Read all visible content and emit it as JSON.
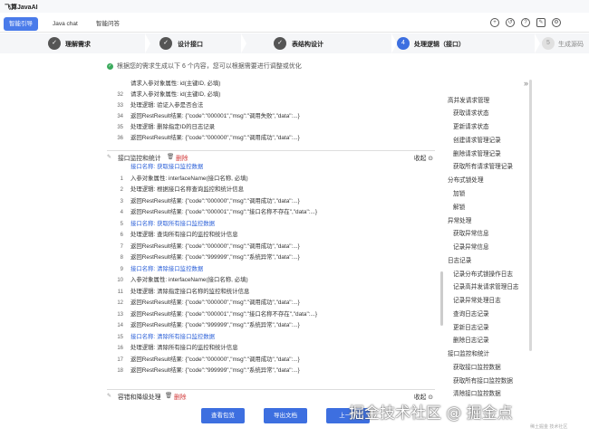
{
  "app": {
    "title": "飞算JavaAI"
  },
  "tabs": [
    {
      "label": "智能引导",
      "active": true
    },
    {
      "label": "Java chat",
      "active": false
    },
    {
      "label": "智能问答",
      "active": false
    }
  ],
  "toolbar_icons": [
    "add-icon",
    "history-icon",
    "help-icon",
    "edit-icon",
    "settings-icon"
  ],
  "steps": [
    {
      "num": "✓",
      "label": "理解需求",
      "state": "done"
    },
    {
      "num": "✓",
      "label": "设计接口",
      "state": "done"
    },
    {
      "num": "✓",
      "label": "表结构设计",
      "state": "done"
    },
    {
      "num": "4",
      "label": "处理逻辑（接口）",
      "state": "active"
    },
    {
      "num": "5",
      "label": "生成源码",
      "state": "todo"
    }
  ],
  "notice": "根据您的需求生成以下 6 个内容，您可以根据需要进行调整或优化",
  "block1": {
    "lines": [
      {
        "n": "",
        "text": "请求入参对象属性: id(主键ID, 必填)",
        "style": "gray"
      },
      {
        "n": "32",
        "text": "请求入参对象属性: id(主键ID, 必填)",
        "style": ""
      },
      {
        "n": "33",
        "text": "处理逻辑: 验证入参是否合法",
        "style": ""
      },
      {
        "n": "34",
        "text": "返回RestResult结果: {\"code\":\"000001\",\"msg\":\"调用失败\",\"data\":...}",
        "style": ""
      },
      {
        "n": "35",
        "text": "处理逻辑: 删除指定ID的日志记录",
        "style": ""
      },
      {
        "n": "36",
        "text": "返回RestResult结果: {\"code\":\"000000\",\"msg\":\"调用成功\",\"data\":...}",
        "style": ""
      }
    ]
  },
  "section2": {
    "title": "接口监控和统计",
    "delete": "删除",
    "collapse": "收起"
  },
  "block2": {
    "lines": [
      {
        "n": "",
        "text": "接口名称: 获取接口监控数据",
        "style": "blue"
      },
      {
        "n": "1",
        "text": "入参对象属性: interfaceName(接口名称, 必填)",
        "style": ""
      },
      {
        "n": "2",
        "text": "处理逻辑: 根据接口名称查询监控和统计信息",
        "style": ""
      },
      {
        "n": "3",
        "text": "返回RestResult结果: {\"code\":\"000000\",\"msg\":\"调用成功\",\"data\":...}",
        "style": ""
      },
      {
        "n": "4",
        "text": "返回RestResult结果: {\"code\":\"000001\",\"msg\":\"接口名称不存在\",\"data\":...}",
        "style": ""
      },
      {
        "n": "5",
        "text": "接口名称: 获取所有接口监控数据",
        "style": "blue"
      },
      {
        "n": "6",
        "text": "处理逻辑: 查询所有接口的监控和统计信息",
        "style": ""
      },
      {
        "n": "7",
        "text": "返回RestResult结果: {\"code\":\"000000\",\"msg\":\"调用成功\",\"data\":...}",
        "style": ""
      },
      {
        "n": "8",
        "text": "返回RestResult结果: {\"code\":\"999999\",\"msg\":\"系统异常\",\"data\":...}",
        "style": ""
      },
      {
        "n": "9",
        "text": "接口名称: 清除接口监控数据",
        "style": "blue"
      },
      {
        "n": "10",
        "text": "入参对象属性: interfaceName(接口名称, 必填)",
        "style": ""
      },
      {
        "n": "11",
        "text": "处理逻辑: 清除指定接口名称的监控和统计信息",
        "style": ""
      },
      {
        "n": "12",
        "text": "返回RestResult结果: {\"code\":\"000000\",\"msg\":\"调用成功\",\"data\":...}",
        "style": ""
      },
      {
        "n": "13",
        "text": "返回RestResult结果: {\"code\":\"000001\",\"msg\":\"接口名称不存在\",\"data\":...}",
        "style": ""
      },
      {
        "n": "14",
        "text": "返回RestResult结果: {\"code\":\"999999\",\"msg\":\"系统异常\",\"data\":...}",
        "style": ""
      },
      {
        "n": "15",
        "text": "接口名称: 清除所有接口监控数据",
        "style": "blue"
      },
      {
        "n": "16",
        "text": "处理逻辑: 清除所有接口的监控和统计信息",
        "style": ""
      },
      {
        "n": "17",
        "text": "返回RestResult结果: {\"code\":\"000000\",\"msg\":\"调用成功\",\"data\":...}",
        "style": ""
      },
      {
        "n": "18",
        "text": "返回RestResult结果: {\"code\":\"999999\",\"msg\":\"系统异常\",\"data\":...}",
        "style": ""
      }
    ]
  },
  "section3": {
    "title": "容错和降级处理",
    "delete": "删除",
    "collapse": "收起"
  },
  "right_panel": [
    {
      "label": "高并发请求管理",
      "level": 0
    },
    {
      "label": "获取请求状态",
      "level": 1
    },
    {
      "label": "更新请求状态",
      "level": 1
    },
    {
      "label": "创建请求管理记录",
      "level": 1
    },
    {
      "label": "删除请求管理记录",
      "level": 1
    },
    {
      "label": "获取所有请求管理记录",
      "level": 1
    },
    {
      "label": "分布式锁处理",
      "level": 0
    },
    {
      "label": "加锁",
      "level": 1
    },
    {
      "label": "解锁",
      "level": 1
    },
    {
      "label": "异常处理",
      "level": 0
    },
    {
      "label": "获取异常信息",
      "level": 1
    },
    {
      "label": "记录异常信息",
      "level": 1
    },
    {
      "label": "日志记录",
      "level": 0
    },
    {
      "label": "记录分布式锁操作日志",
      "level": 1
    },
    {
      "label": "记录高并发请求管理日志",
      "level": 1
    },
    {
      "label": "记录异常处理日志",
      "level": 1
    },
    {
      "label": "查询日志记录",
      "level": 1
    },
    {
      "label": "更新日志记录",
      "level": 1
    },
    {
      "label": "删除日志记录",
      "level": 1
    },
    {
      "label": "接口监控和统计",
      "level": 0
    },
    {
      "label": "获取接口监控数据",
      "level": 1
    },
    {
      "label": "获取所有接口监控数据",
      "level": 1
    },
    {
      "label": "清除接口监控数据",
      "level": 1
    }
  ],
  "buttons": {
    "view_all": "查看包览",
    "export_doc": "导出文档",
    "next": "上一步"
  },
  "watermark": "掘金技术社区 @ 掘金点",
  "watermark_sub": "稀土掘金 技术社区"
}
